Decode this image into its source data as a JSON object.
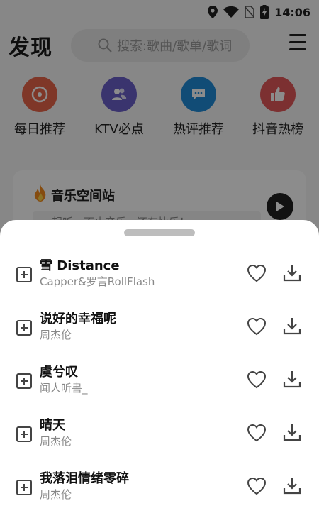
{
  "status_bar": {
    "time": "14:06",
    "icons": [
      "location-icon",
      "wifi-icon",
      "no-sim-icon",
      "battery-charging-icon"
    ]
  },
  "header": {
    "title": "发现",
    "search_placeholder": "搜索:歌曲/歌单/歌词",
    "menu_icon": "hamburger-menu-icon"
  },
  "entries": [
    {
      "label": "每日推荐",
      "icon": "disc-icon",
      "color": "#e8654a"
    },
    {
      "label": "KTV必点",
      "icon": "people-icon",
      "color": "#6a5fc9"
    },
    {
      "label": "热评推荐",
      "icon": "comment-icon",
      "color": "#1f8ad8"
    },
    {
      "label": "抖音热榜",
      "icon": "thumbs-up-icon",
      "color": "#e2585a"
    }
  ],
  "music_space": {
    "title": "音乐空间站",
    "subtitle": "一起听，不止音乐，还有快乐！",
    "icon": "flame-icon"
  },
  "songs": [
    {
      "name": "雪 Distance",
      "artist": "Capper&罗言RollFlash"
    },
    {
      "name": "说好的幸福呢",
      "artist": "周杰伦"
    },
    {
      "name": "虞兮叹",
      "artist": "闻人听書_"
    },
    {
      "name": "晴天",
      "artist": "周杰伦"
    },
    {
      "name": "我落泪情绪零碎",
      "artist": "周杰伦"
    }
  ]
}
